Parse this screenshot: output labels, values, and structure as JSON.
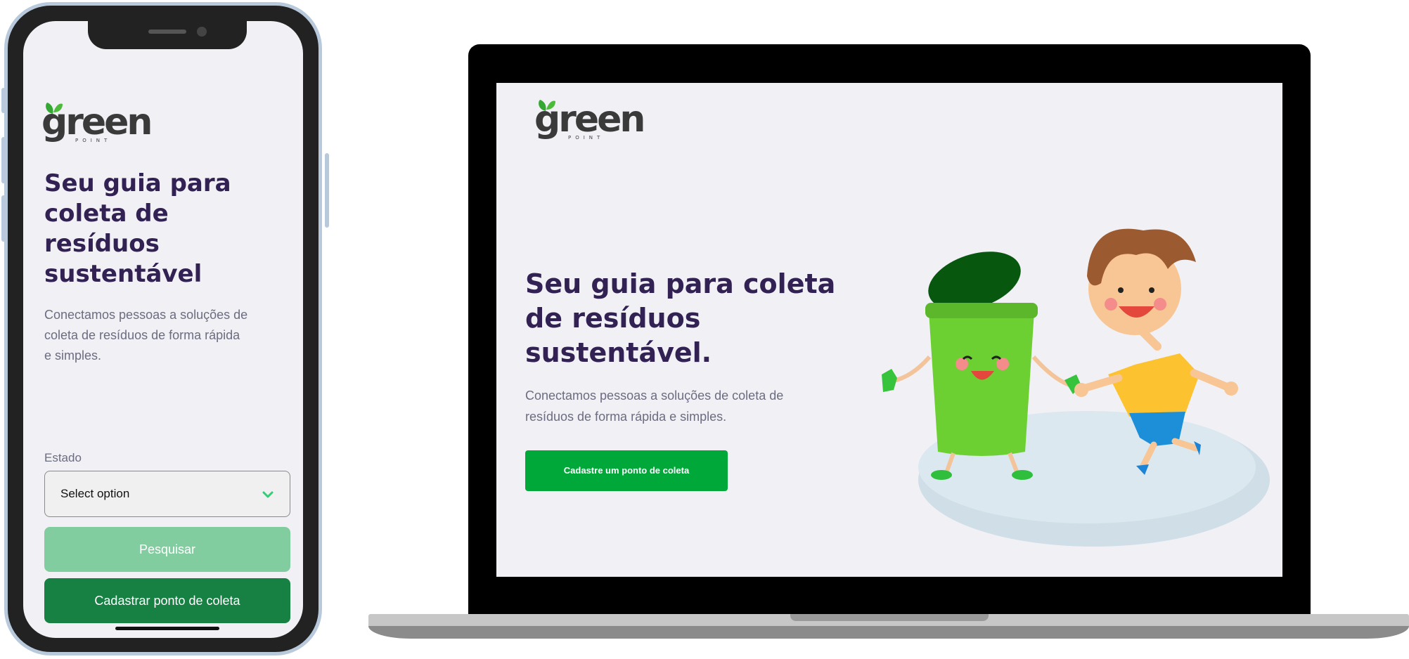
{
  "mobile": {
    "brand": {
      "word": "green",
      "sub": "POINT"
    },
    "hero_title": "Seu guia para coleta de resíduos sustentável",
    "hero_description": "Conectamos pessoas a soluções de coleta de resíduos de forma rápida e simples.",
    "state_label": "Estado",
    "state_select": {
      "value": "Select option",
      "icon": "chevron-down-icon"
    },
    "search_button": "Pesquisar",
    "register_button": "Cadastrar ponto de coleta"
  },
  "desktop": {
    "brand": {
      "word": "green",
      "sub": "POINT"
    },
    "hero_title": "Seu guia para coleta de resíduos sustentável.",
    "hero_description": "Conectamos pessoas a soluções de coleta de resíduos de forma rápida e simples.",
    "register_button": "Cadastre um ponto de coleta"
  },
  "colors": {
    "title": "#322153",
    "text": "#6c6c80",
    "background": "#f0f0f5",
    "primary_desktop": "#00a83a",
    "primary_mobile": "#178043",
    "search_disabled": "#82cda0"
  }
}
